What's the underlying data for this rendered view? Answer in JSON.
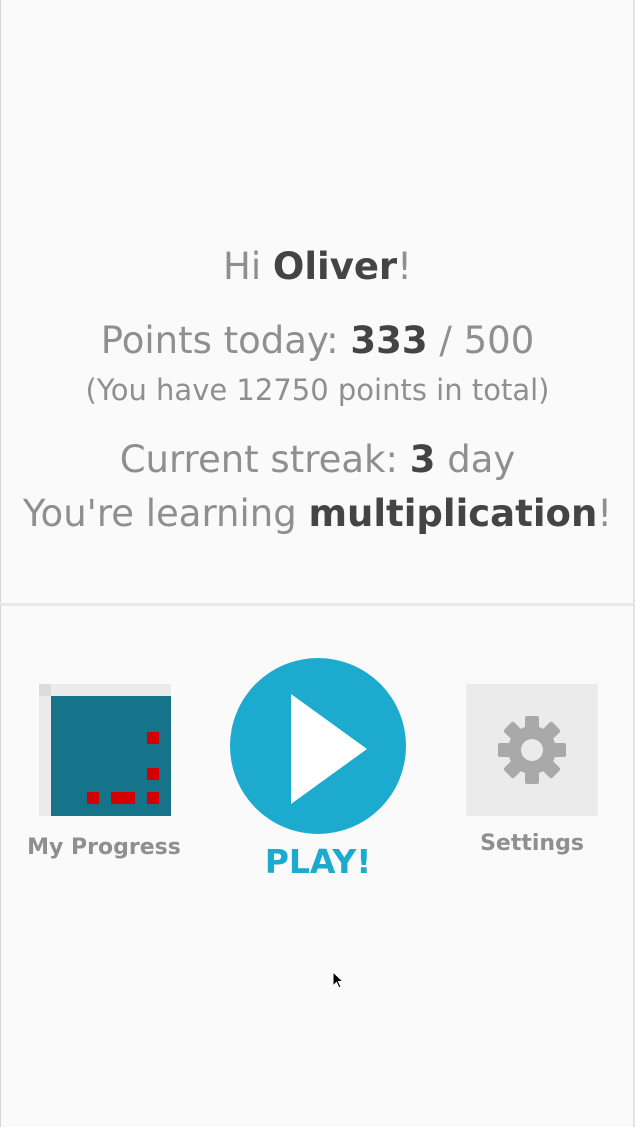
{
  "greeting": {
    "prefix": "Hi ",
    "name": "Oliver",
    "suffix": "!"
  },
  "points": {
    "label": "Points today: ",
    "today": "333",
    "separator": " / ",
    "goal": "500"
  },
  "total": {
    "text": "(You have 12750 points in total)"
  },
  "streak": {
    "label": "Current streak: ",
    "value": "3",
    "unit": " day"
  },
  "learning": {
    "prefix": "You're learning ",
    "topic": "multiplication",
    "suffix": "!"
  },
  "nav": {
    "progress": {
      "label": "My Progress",
      "icon": "progress-grid-icon"
    },
    "play": {
      "label": "PLAY!",
      "icon": "play-icon"
    },
    "settings": {
      "label": "Settings",
      "icon": "gear-icon"
    }
  },
  "colors": {
    "accent": "#1caace",
    "progress_board": "#157489",
    "progress_mark": "#d20000",
    "text_muted": "#8f8f8f",
    "text_strong": "#444444"
  }
}
